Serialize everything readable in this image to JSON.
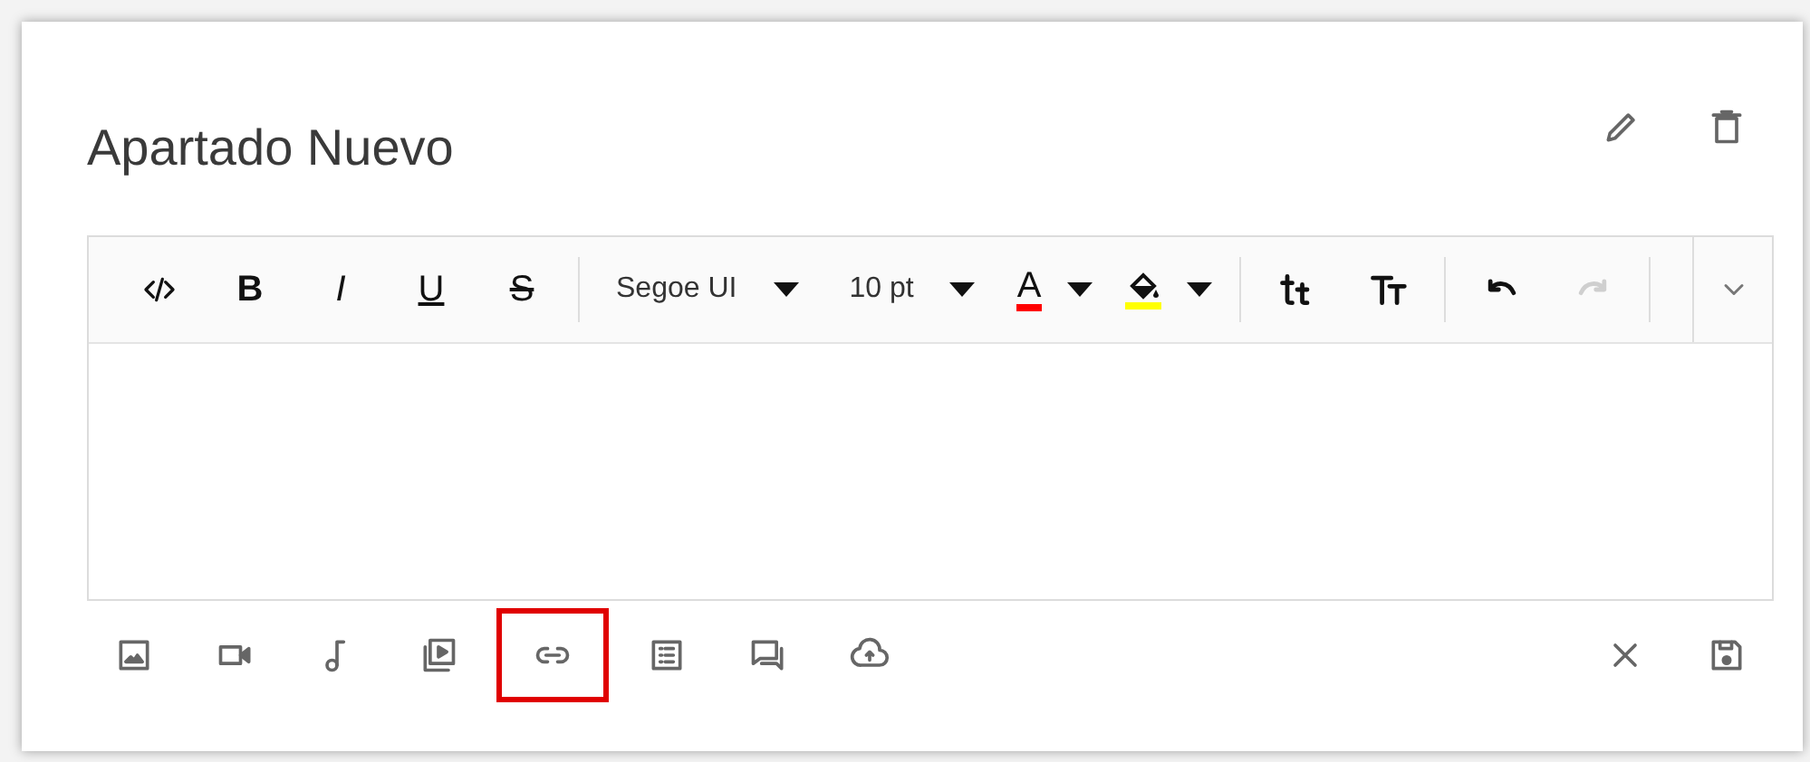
{
  "section": {
    "title": "Apartado Nuevo"
  },
  "header_actions": [
    {
      "kind": "edit"
    },
    {
      "kind": "delete"
    }
  ],
  "toolbar": [
    {
      "kind": "code"
    },
    {
      "kind": "bold",
      "label": "B"
    },
    {
      "kind": "italic",
      "label": "I"
    },
    {
      "kind": "underline",
      "label": "U"
    },
    {
      "kind": "strike",
      "label": "S"
    },
    {
      "kind": "separator"
    },
    {
      "kind": "dropdown",
      "label": "Segoe UI"
    },
    {
      "kind": "dropdown",
      "label": "10 pt"
    },
    {
      "kind": "color",
      "label": "A",
      "color": "#ff0000"
    },
    {
      "kind": "fill",
      "color": "#ffff00"
    },
    {
      "kind": "separator"
    },
    {
      "kind": "shrink"
    },
    {
      "kind": "grow"
    },
    {
      "kind": "separator"
    },
    {
      "kind": "undo",
      "disabled": false
    },
    {
      "kind": "redo",
      "disabled": true
    },
    {
      "kind": "separator"
    }
  ],
  "attachments": [
    {
      "kind": "image",
      "highlighted": false
    },
    {
      "kind": "video",
      "highlighted": false
    },
    {
      "kind": "audio",
      "highlighted": false
    },
    {
      "kind": "media",
      "highlighted": false
    },
    {
      "kind": "link",
      "highlighted": true
    },
    {
      "kind": "list",
      "highlighted": false
    },
    {
      "kind": "comments",
      "highlighted": false
    },
    {
      "kind": "upload",
      "highlighted": false
    }
  ],
  "footer_actions": [
    {
      "kind": "cancel"
    },
    {
      "kind": "save"
    }
  ]
}
